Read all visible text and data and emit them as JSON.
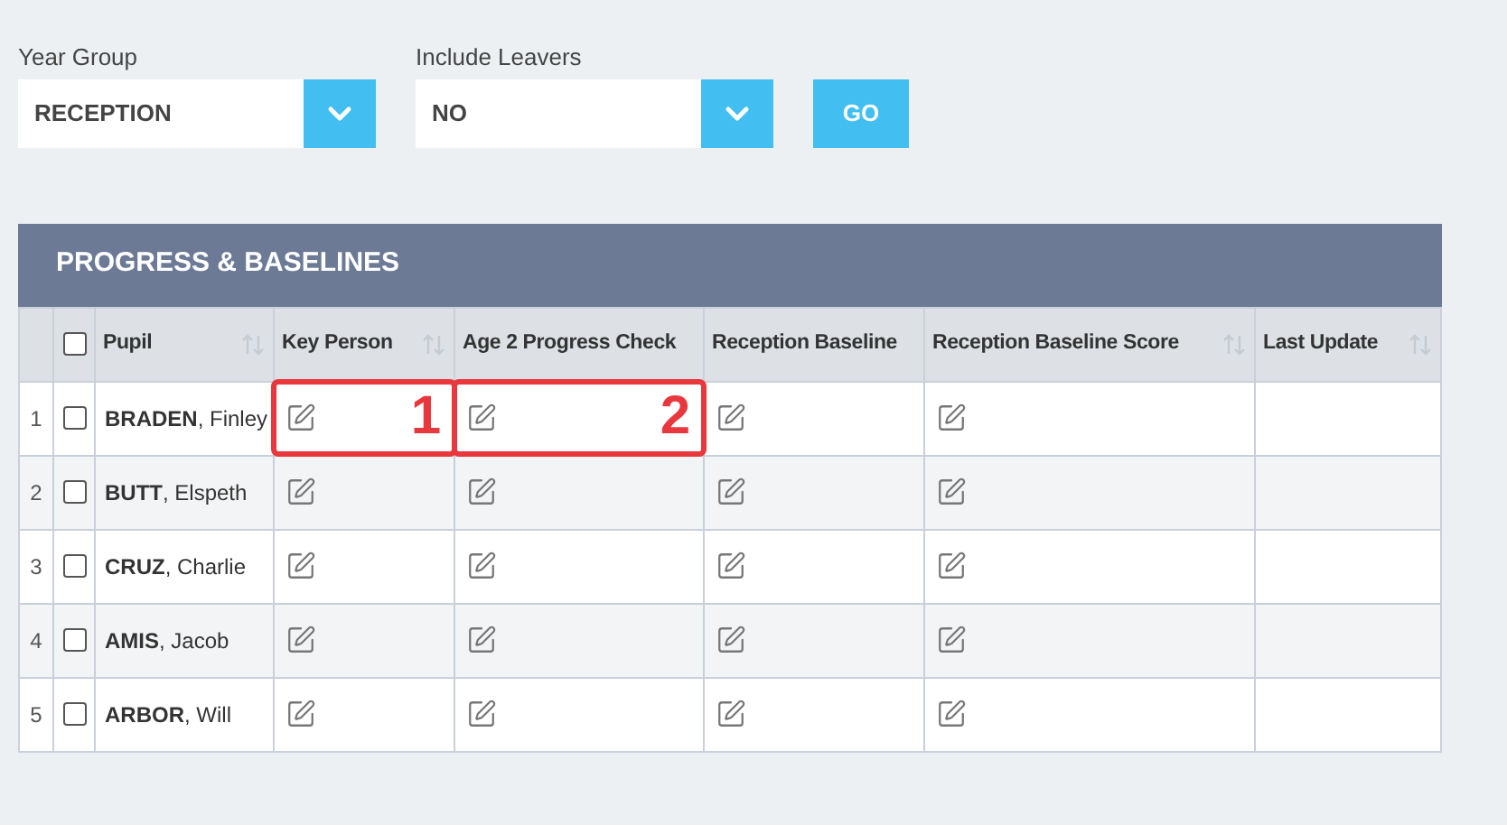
{
  "filters": [
    {
      "label": "Year Group",
      "value": "RECEPTION"
    },
    {
      "label": "Include Leavers",
      "value": "NO"
    }
  ],
  "go_button": "GO",
  "panel": {
    "title": "PROGRESS & BASELINES"
  },
  "table": {
    "select_all_checked": false,
    "columns": [
      {
        "label": "Pupil",
        "sortable": true
      },
      {
        "label": "Key Person",
        "sortable": true
      },
      {
        "label": "Age 2 Progress Check",
        "sortable": false
      },
      {
        "label": "Reception Baseline",
        "sortable": false
      },
      {
        "label": "Reception Baseline Score",
        "sortable": true
      },
      {
        "label": "Last Update",
        "sortable": true
      }
    ],
    "rows": [
      {
        "index": "1",
        "checked": false,
        "cells": [
          {
            "kind": "name",
            "text": "**BRADEN**, Finley"
          },
          {
            "kind": "edit",
            "callout": "1"
          },
          {
            "kind": "edit",
            "callout": "2"
          },
          {
            "kind": "edit"
          },
          {
            "kind": "edit"
          },
          {
            "kind": "empty"
          }
        ]
      },
      {
        "index": "2",
        "checked": false,
        "cells": [
          {
            "kind": "name",
            "text": "**BUTT**, Elspeth"
          },
          {
            "kind": "edit"
          },
          {
            "kind": "edit"
          },
          {
            "kind": "edit"
          },
          {
            "kind": "edit"
          },
          {
            "kind": "empty"
          }
        ]
      },
      {
        "index": "3",
        "checked": false,
        "cells": [
          {
            "kind": "name",
            "text": "**CRUZ**, Charlie"
          },
          {
            "kind": "edit"
          },
          {
            "kind": "edit"
          },
          {
            "kind": "edit"
          },
          {
            "kind": "edit"
          },
          {
            "kind": "empty"
          }
        ]
      },
      {
        "index": "4",
        "checked": false,
        "cells": [
          {
            "kind": "name",
            "text": "**AMIS**, Jacob"
          },
          {
            "kind": "edit"
          },
          {
            "kind": "edit"
          },
          {
            "kind": "edit"
          },
          {
            "kind": "edit"
          },
          {
            "kind": "empty"
          }
        ]
      },
      {
        "index": "5",
        "checked": false,
        "cells": [
          {
            "kind": "name",
            "text": "**ARBOR**, Will"
          },
          {
            "kind": "edit"
          },
          {
            "kind": "edit"
          },
          {
            "kind": "edit"
          },
          {
            "kind": "edit"
          },
          {
            "kind": "empty"
          }
        ]
      }
    ]
  }
}
